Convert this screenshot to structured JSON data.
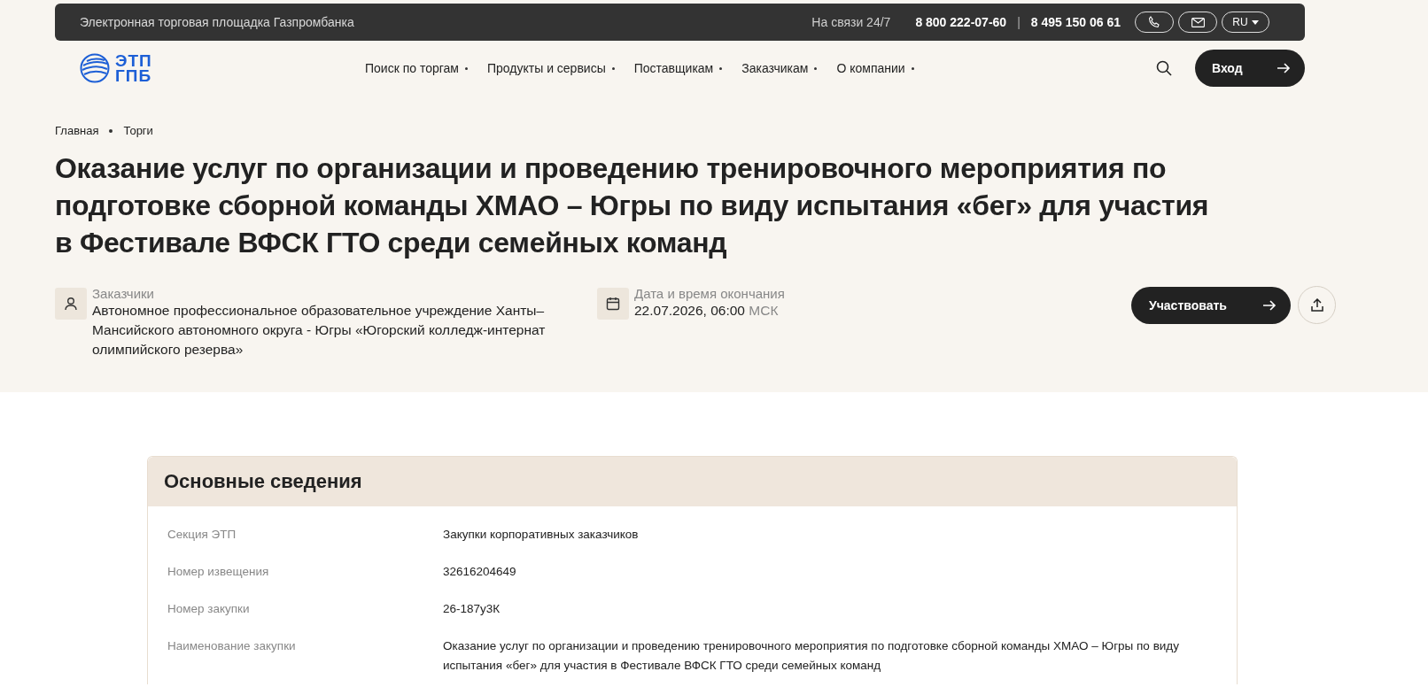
{
  "top_bar": {
    "title": "Электронная торговая площадка Газпромбанка",
    "support_label": "На связи 24/7",
    "phones": [
      "8 800 222-07-60",
      "8 495 150 06 61"
    ],
    "separator": "|",
    "language": "RU"
  },
  "header": {
    "logo": [
      "ЭТП",
      "ГПБ"
    ],
    "nav": [
      "Поиск по торгам",
      "Продукты и сервисы",
      "Поставщикам",
      "Заказчикам",
      "О компании"
    ],
    "login": "Вход"
  },
  "breadcrumbs": [
    "Главная",
    "Торги"
  ],
  "title": "Оказание услуг по организации и проведению тренировочного мероприятия по подготовке сборной команды ХМАО – Югры по виду испытания «бег» для участия в Фестивале ВФСК ГТО среди семейных команд",
  "meta": [
    {
      "kind": "customer",
      "label": "Заказчики",
      "value": "Автономное профессиональное образовательное учреждение Ханты–Мансийского автономного округа - Югры «Югорский колледж-интернат олимпийского резерва»"
    },
    {
      "kind": "date",
      "label": "Дата и время окончания",
      "value": "22.07.2026, 06:00",
      "suffix": "МСК"
    }
  ],
  "participate": "Участвовать",
  "card": {
    "title": "Основные сведения",
    "rows": [
      {
        "label": "Секция ЭТП",
        "value": "Закупки корпоративных заказчиков"
      },
      {
        "label": "Номер извещения",
        "value": "32616204649"
      },
      {
        "label": "Номер закупки",
        "value": "26-187у3К"
      },
      {
        "label": "Наименование закупки",
        "value": "Оказание услуг по организации и проведению тренировочного мероприятия по подготовке сборной команды ХМАО – Югры по виду испытания «бег» для участия в Фестивале ВФСК ГТО среди семейных команд"
      }
    ]
  }
}
